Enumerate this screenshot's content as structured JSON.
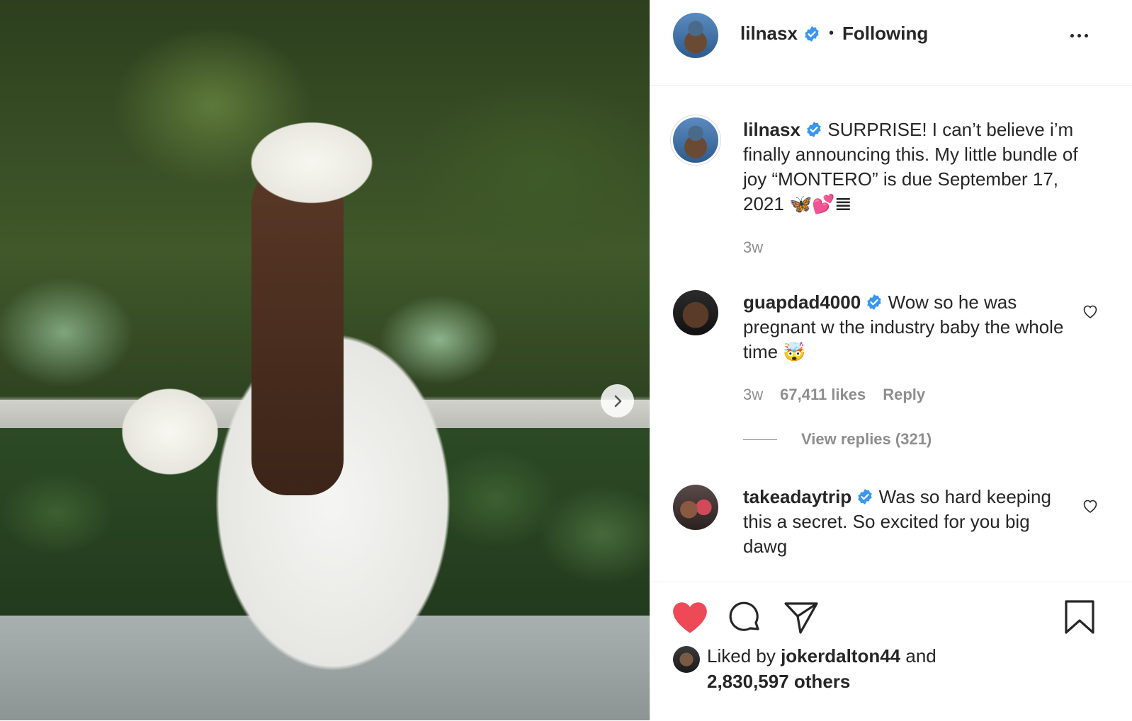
{
  "post": {
    "username": "lilnasx",
    "follow_status": "Following",
    "separator": "•"
  },
  "caption": {
    "username": "lilnasx",
    "text": "SURPRISE! I can’t believe i’m finally announcing this. My little bundle of joy “MONTERO” is due September 17, 2021 🦋💕𝌆",
    "time": "3w"
  },
  "comments": [
    {
      "username": "guapdad4000",
      "text": "Wow so he was pregnant w the industry baby the whole time 🤯",
      "time": "3w",
      "likes": "67,411 likes",
      "reply_label": "Reply",
      "view_replies": "View replies (321)"
    },
    {
      "username": "takeadaytrip",
      "text": "Was so hard keeping this a secret. So excited for you big dawg"
    }
  ],
  "likes": {
    "prefix": "Liked by",
    "user": "jokerdalton44",
    "and": "and",
    "others": "2,830,597 others"
  },
  "icons": {
    "header_more": "more-horizontal-icon",
    "next": "chevron-right-icon",
    "like": "heart-filled-icon",
    "comment": "comment-bubble-icon",
    "share": "paper-plane-icon",
    "save": "bookmark-icon",
    "verified": "verified-badge-icon"
  },
  "colors": {
    "like_red": "#ed4956",
    "verified_blue": "#3897f0",
    "muted_text": "#8e8e8e"
  }
}
